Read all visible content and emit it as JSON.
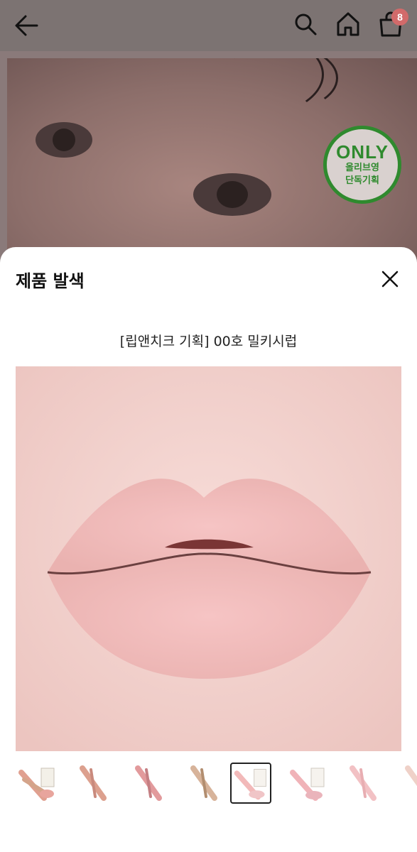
{
  "header": {
    "back_icon": "arrow-left-icon",
    "search_icon": "search-icon",
    "home_icon": "home-icon",
    "cart_icon": "shopping-bag-icon",
    "cart_count": "8"
  },
  "hero": {
    "badge_title": "ONLY",
    "badge_line1": "올리브영",
    "badge_line2": "단독기획",
    "badge_color": "#2f8a2e"
  },
  "sheet": {
    "title": "제품 발색",
    "close_icon": "close-icon",
    "option_name": "[립앤치크 기획] 00호 밀키시럽",
    "thumbnails": [
      {
        "name": "swatch-thumb-1",
        "selected": false
      },
      {
        "name": "swatch-thumb-2",
        "selected": false
      },
      {
        "name": "swatch-thumb-3",
        "selected": false
      },
      {
        "name": "swatch-thumb-4",
        "selected": false
      },
      {
        "name": "swatch-thumb-5",
        "selected": true
      },
      {
        "name": "swatch-thumb-6",
        "selected": false
      },
      {
        "name": "swatch-thumb-7",
        "selected": false
      },
      {
        "name": "swatch-thumb-8",
        "selected": false
      }
    ]
  }
}
